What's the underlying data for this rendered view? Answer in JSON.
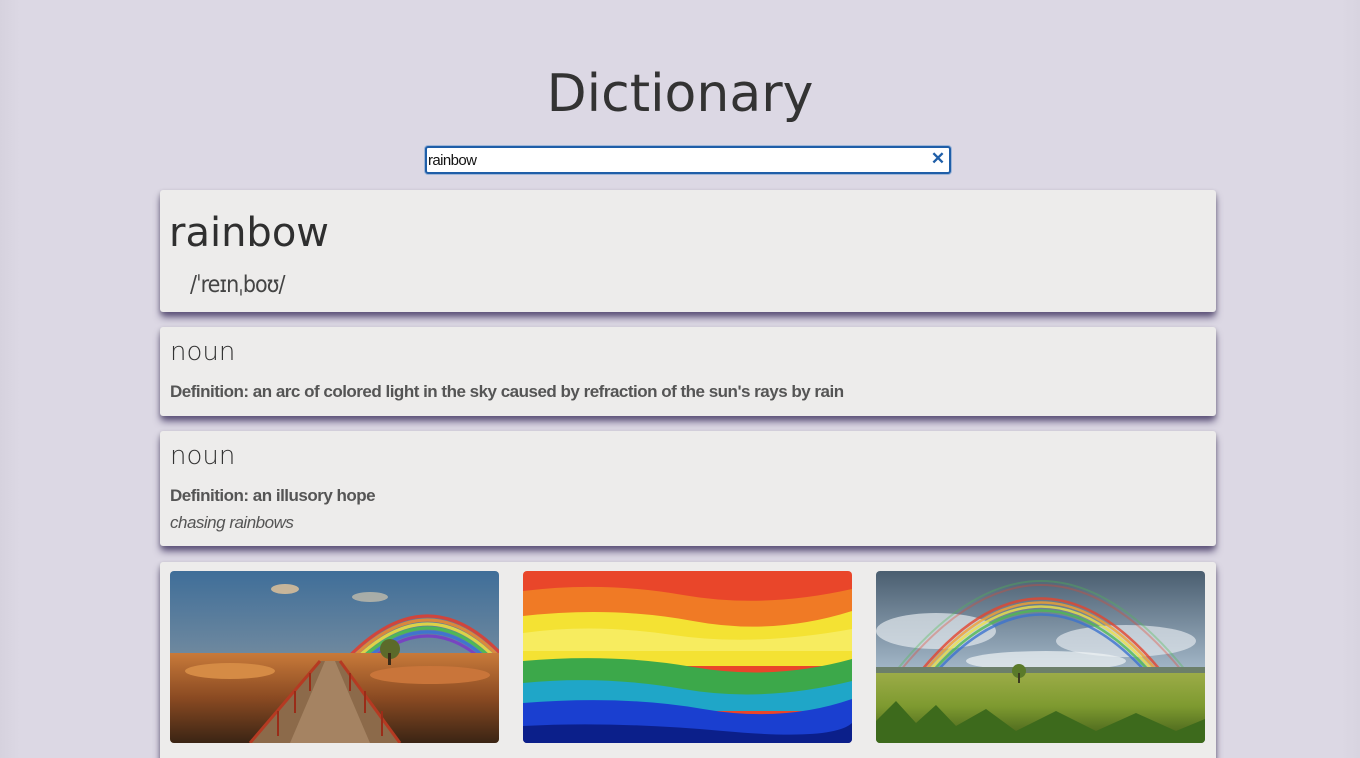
{
  "app": {
    "title": "Dictionary"
  },
  "search": {
    "value": "rainbow"
  },
  "entry": {
    "word": "rainbow",
    "phonetic": "/ˈreɪnˌboʊ/",
    "meanings": [
      {
        "part_of_speech": "noun",
        "definition_label": "Definition:",
        "definition": "an arc of colored light in the sky caused by refraction of the sun's rays by rain"
      },
      {
        "part_of_speech": "noun",
        "definition_label": "Definition:",
        "definition": "an illusory hope",
        "example": "chasing rainbows"
      }
    ]
  },
  "photos": [
    {
      "name": "rainbow-over-boardwalk-photo"
    },
    {
      "name": "rainbow-painting-photo"
    },
    {
      "name": "double-rainbow-field-photo"
    }
  ],
  "colors": {
    "background": "#dcd8e4",
    "card": "#edeceb",
    "accent": "#1f5ea8",
    "shadow": "#5a4f78"
  }
}
